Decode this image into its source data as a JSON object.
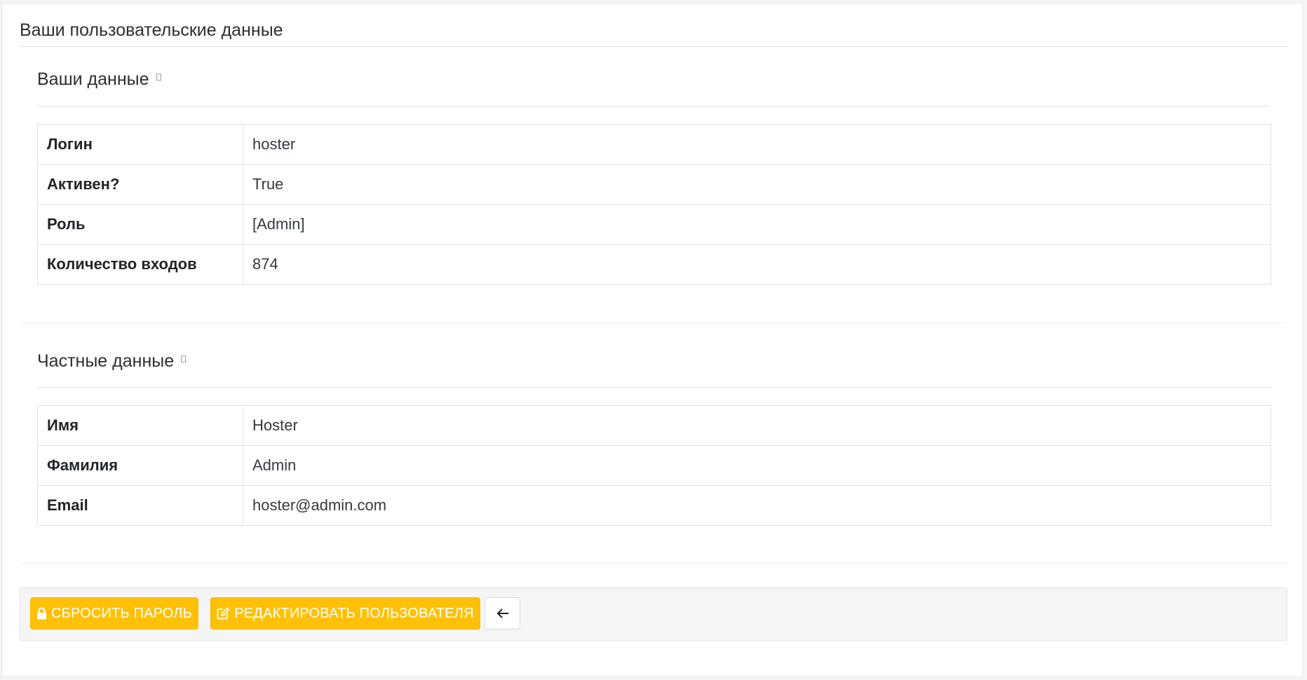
{
  "page": {
    "title": "Ваши пользовательские данные"
  },
  "sections": [
    {
      "heading": "Ваши данные",
      "rows": [
        {
          "label": "Логин",
          "value": "hoster"
        },
        {
          "label": "Активен?",
          "value": "True"
        },
        {
          "label": "Роль",
          "value": "[Admin]"
        },
        {
          "label": "Количество входов",
          "value": "874"
        }
      ]
    },
    {
      "heading": "Частные данные",
      "rows": [
        {
          "label": "Имя",
          "value": "Hoster"
        },
        {
          "label": "Фамилия",
          "value": "Admin"
        },
        {
          "label": "Email",
          "value": "hoster@admin.com"
        }
      ]
    }
  ],
  "actions": {
    "reset_password": {
      "label": "СБРОСИТЬ ПАРОЛЬ",
      "icon": "lock-icon"
    },
    "edit_user": {
      "label": "РЕДАКТИРОВАТЬ ПОЛЬЗОВАТЕЛЯ",
      "icon": "edit-icon"
    },
    "back": {
      "icon": "arrow-left-icon"
    }
  },
  "colors": {
    "accent": "#ffc107",
    "toolbar_bg": "#f5f5f5"
  }
}
